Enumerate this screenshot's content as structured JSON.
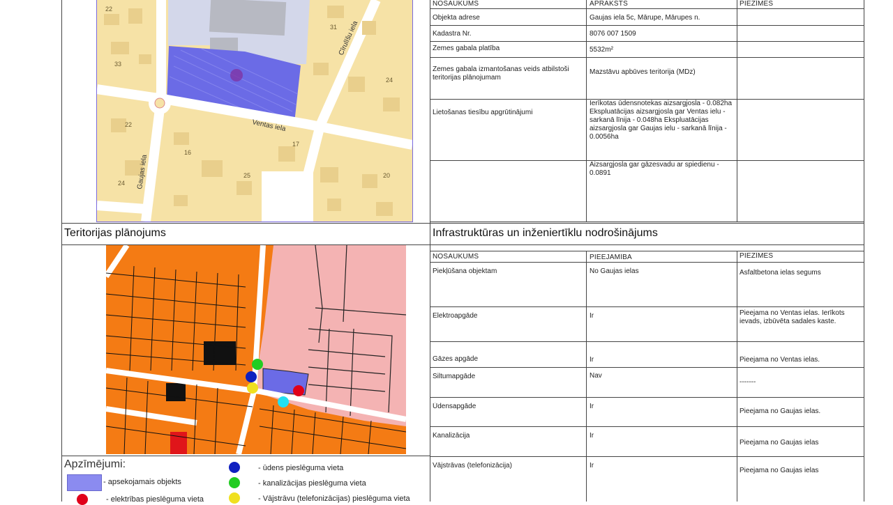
{
  "top_table": {
    "headers": {
      "name": "NOSAUKUMS",
      "description": "APRAKSTS",
      "notes": "PIEZĪMES"
    },
    "rows": [
      {
        "name": "Objekta adrese",
        "value": "Gaujas iela 5c, Mārupe, Mārupes n.",
        "note": ""
      },
      {
        "name": "Kadastra Nr.",
        "value": "8076 007 1509",
        "note": ""
      },
      {
        "name": "Zemes gabala platība",
        "value": "5532m²",
        "note": ""
      },
      {
        "name": "Zemes gabala izmantošanas veids atbilstoši teritorijas plānojumam",
        "value": "Mazstāvu apbūves teritorija (MDz)",
        "note": ""
      },
      {
        "name": "Lietošanas tiesību apgrūtinājumi",
        "value": "Ierīkotas ūdensnotekas aizsargjosla - 0.082ha Ekspluatācijas aizsargjosla gar Ventas ielu - sarkanā līnija - 0.048ha Ekspluatācijas aizsargjosla gar Gaujas ielu - sarkanā līnija - 0.0056ha",
        "note": ""
      },
      {
        "name": "",
        "value": "Aizsargjosla gar gāzesvadu ar spiedienu - 0.0891",
        "note": ""
      }
    ]
  },
  "street_map": {
    "labels": {
      "ventas": "Ventas iela",
      "gaujas": "Gaujas iela",
      "cirulisu": "Cīrulīšu iela"
    },
    "numbers": [
      "22",
      "33",
      "31",
      "24",
      "22",
      "16",
      "25",
      "17",
      "20",
      "24"
    ]
  },
  "sections": {
    "planning_title": "Teritorijas plānojums",
    "infrastructure_title": "Infrastruktūras un inženiertīklu nodrošinājums"
  },
  "infra_table": {
    "headers": {
      "name": "NOSAUKUMS",
      "availability": "PIEEJAMĪBA",
      "notes": "PIEZĪMES"
    },
    "rows": [
      {
        "name": "Piekļūšana objektam",
        "availability": "No Gaujas ielas",
        "note": "Asfaltbetona ielas segums"
      },
      {
        "name": "Elektroapgāde",
        "availability": "Ir",
        "note": "Pieejama no Ventas ielas. Ierīkots ievads, izbūvēta sadales kaste."
      },
      {
        "name": "Gāzes apgāde",
        "availability": "Ir",
        "note": "Pieejama no Ventas ielas."
      },
      {
        "name": "Siltumapgāde",
        "availability": "Nav",
        "note": "-------"
      },
      {
        "name": "Ūdensapgāde",
        "availability": "Ir",
        "note": "Pieejama no Gaujas ielas."
      },
      {
        "name": "Kanalizācija",
        "availability": "Ir",
        "note": "Pieejama no Gaujas ielas"
      },
      {
        "name": "Vājstrāvas (telefonizācija)",
        "availability": "Ir",
        "note": "Pieejama no Gaujas ielas"
      }
    ]
  },
  "legend": {
    "title": "Apzīmējumi:",
    "items": [
      {
        "label": "- apsekojamais objekts",
        "color": "#6a6ae6",
        "shape": "rect"
      },
      {
        "label": "- elektrības pieslēguma vieta",
        "color": "#e0001a",
        "shape": "dot"
      },
      {
        "label": "- ūdens pieslēguma vieta",
        "color": "#1020c0",
        "shape": "dot"
      },
      {
        "label": "- kanalizācijas pieslēguma vieta",
        "color": "#22cc22",
        "shape": "dot"
      },
      {
        "label": "- Vājstrāvu (telefonizācijas) pieslēguma vieta",
        "color": "#f0e020",
        "shape": "dot"
      }
    ]
  },
  "colors": {
    "residential_orange": "#f47b14",
    "pink_zone": "#f4b3b3",
    "object_blue": "#6b6be6",
    "map_beige": "#f5dfa0",
    "map_gray": "#cfd3e8"
  }
}
